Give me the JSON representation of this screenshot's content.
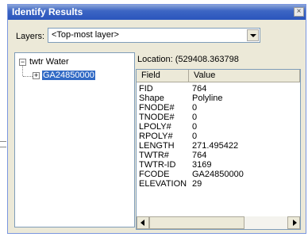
{
  "window": {
    "title": "Identify Results",
    "close_glyph": "×"
  },
  "layers": {
    "label": "Layers:",
    "selected": "<Top-most layer>"
  },
  "tree": {
    "root": {
      "toggle": "−",
      "label": "twtr Water"
    },
    "child": {
      "toggle": "+",
      "label": "GA24850000"
    }
  },
  "location": {
    "text": "Location: (529408.363798"
  },
  "grid": {
    "headers": {
      "field": "Field",
      "value": "Value"
    },
    "rows": [
      {
        "field": "FID",
        "value": "764"
      },
      {
        "field": "Shape",
        "value": "Polyline"
      },
      {
        "field": "FNODE#",
        "value": "0"
      },
      {
        "field": "TNODE#",
        "value": "0"
      },
      {
        "field": "LPOLY#",
        "value": "0"
      },
      {
        "field": "RPOLY#",
        "value": "0"
      },
      {
        "field": "LENGTH",
        "value": "271.495422"
      },
      {
        "field": "TWTR#",
        "value": "764"
      },
      {
        "field": "TWTR-ID",
        "value": "3169"
      },
      {
        "field": "FCODE",
        "value": "GA24850000"
      },
      {
        "field": "ELEVATION",
        "value": "29"
      }
    ]
  }
}
